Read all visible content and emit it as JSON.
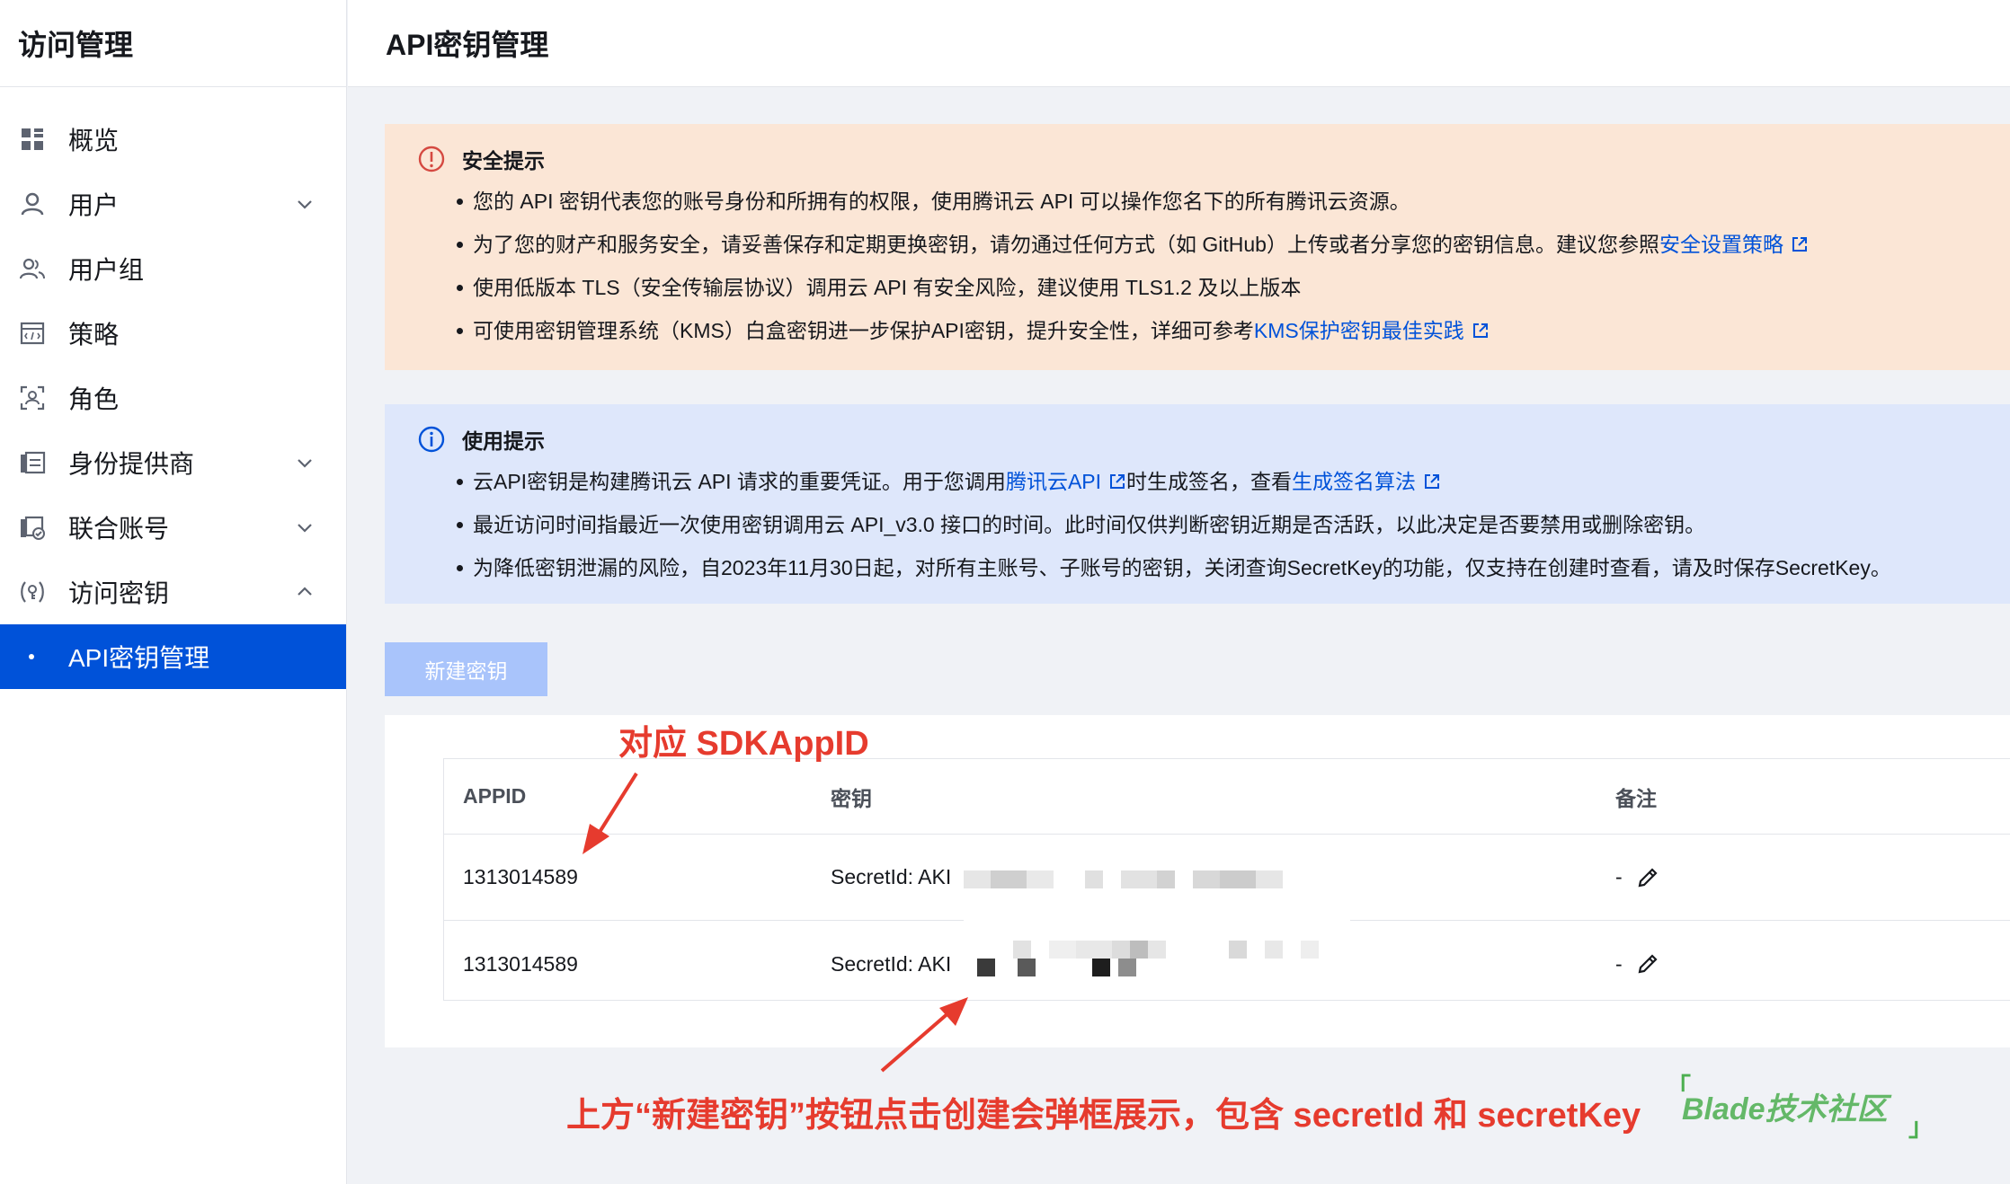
{
  "sidebar": {
    "title": "访问管理",
    "items": [
      {
        "label": "概览",
        "icon": "grid-icon"
      },
      {
        "label": "用户",
        "icon": "user-icon",
        "expandable": true
      },
      {
        "label": "用户组",
        "icon": "user-group-icon"
      },
      {
        "label": "策略",
        "icon": "policy-icon"
      },
      {
        "label": "角色",
        "icon": "role-icon"
      },
      {
        "label": "身份提供商",
        "icon": "identity-provider-icon",
        "expandable": true
      },
      {
        "label": "联合账号",
        "icon": "federated-account-icon",
        "expandable": true
      },
      {
        "label": "访问密钥",
        "icon": "access-key-icon",
        "expanded": true
      },
      {
        "label": "API密钥管理",
        "active": true
      }
    ]
  },
  "header": {
    "title": "API密钥管理"
  },
  "security_notice": {
    "title": "安全提示",
    "items": [
      {
        "text": "您的 API 密钥代表您的账号身份和所拥有的权限，使用腾讯云 API 可以操作您名下的所有腾讯云资源。"
      },
      {
        "text": "为了您的财产和服务安全，请妥善保存和定期更换密钥，请勿通过任何方式（如 GitHub）上传或者分享您的密钥信息。建议您参照",
        "link": "安全设置策略"
      },
      {
        "text": "使用低版本 TLS（安全传输层协议）调用云 API 有安全风险，建议使用 TLS1.2 及以上版本"
      },
      {
        "text": "可使用密钥管理系统（KMS）白盒密钥进一步保护API密钥，提升安全性，详细可参考",
        "link": "KMS保护密钥最佳实践"
      }
    ],
    "colors": {
      "background": "#fbe6d6",
      "icon": "#d54941"
    }
  },
  "usage_notice": {
    "title": "使用提示",
    "item1": {
      "before": "云API密钥是构建腾讯云 API 请求的重要凭证。用于您调用",
      "link1": "腾讯云API",
      "middle": "时生成签名，查看",
      "link2": "生成签名算法"
    },
    "item2": "最近访问时间指最近一次使用密钥调用云 API_v3.0 接口的时间。此时间仅供判断密钥近期是否活跃，以此决定是否要禁用或删除密钥。",
    "item3": "为降低密钥泄漏的风险，自2023年11月30日起，对所有主账号、子账号的密钥，关闭查询SecretKey的功能，仅支持在创建时查看，请及时保存SecretKey。",
    "colors": {
      "background": "#dee7fb",
      "icon": "#0052d9"
    }
  },
  "create_button": {
    "label": "新建密钥"
  },
  "table": {
    "columns": [
      "APPID",
      "密钥",
      "备注"
    ],
    "rows": [
      {
        "appid": "1313014589",
        "secret_prefix": "SecretId: AKI",
        "secret_suffix": "M0",
        "note": "-"
      },
      {
        "appid": "1313014589",
        "secret_prefix": "SecretId: AKI",
        "secret_suffix": "dR2",
        "note": "-"
      }
    ]
  },
  "annotations": {
    "top": "对应 SDKAppID",
    "bottom": "上方“新建密钥”按钮点击创建会弹框展示，包含 secretId 和 secretKey",
    "color": "#e63b2e"
  },
  "watermark": {
    "text": "Blade技术社区"
  }
}
